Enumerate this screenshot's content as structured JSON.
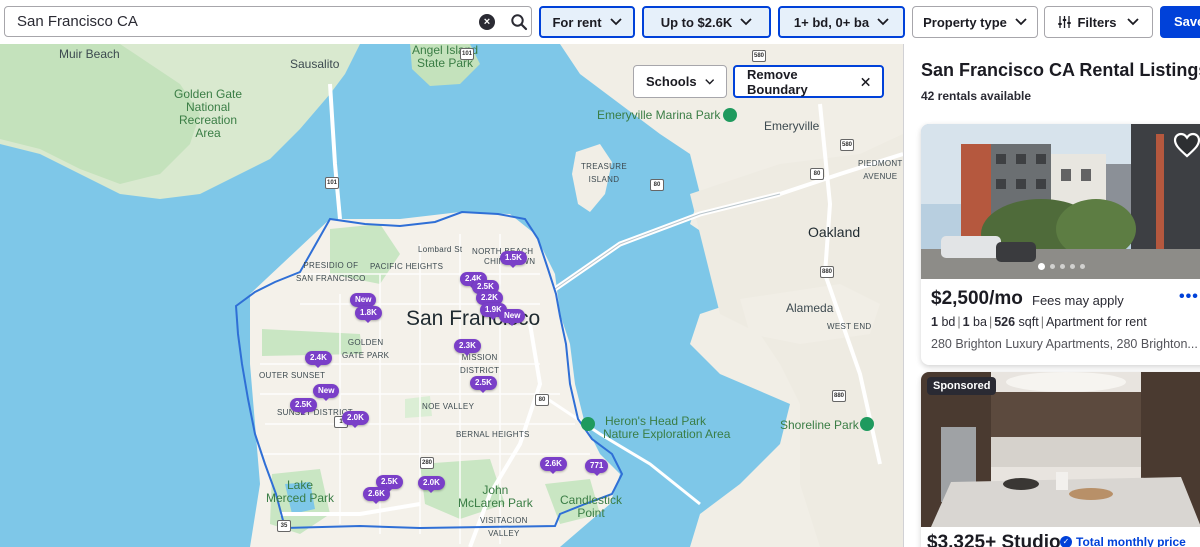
{
  "search": {
    "value": "San Francisco CA"
  },
  "filters": {
    "listing_type": "For rent",
    "price": "Up to $2.6K",
    "beds_baths": "1+ bd, 0+ ba",
    "property_type": "Property type",
    "more_filters": "Filters",
    "save": "Save"
  },
  "map": {
    "schools_button": "Schools",
    "remove_boundary_button": "Remove Boundary",
    "labels": {
      "muir_beach": "Muir Beach",
      "sausalito": "Sausalito",
      "angel_island": "Angel Island\nState Park",
      "golden_gate": "Golden Gate\nNational\nRecreation\nArea",
      "emeryville_marina": "Emeryville Marina Park",
      "emeryville": "Emeryville",
      "treasure_island": "TREASURE\nISLAND",
      "piedmont": "PIEDMONT\nAVENUE",
      "oakland": "Oakland",
      "north_beach": "NORTH BEACH",
      "chinatown": "CHINATOWN",
      "lombard": "Lombard St",
      "presidio": "PRESIDIO OF\nSAN FRANCISCO",
      "pacific_heights": "PACIFIC HEIGHTS",
      "san_francisco": "San Francisco",
      "golden_gate_park": "GOLDEN\nGATE PARK",
      "outer_sunset": "OUTER SUNSET",
      "mission_district": "MISSION\nDISTRICT",
      "sunset_district": "SUNSET DISTRICT",
      "noe_valley": "NOE VALLEY",
      "bernal_heights": "BERNAL HEIGHTS",
      "alameda": "Alameda",
      "west_end": "WEST END",
      "herons_head": "Heron's Head Park",
      "nature_area": "Nature Exploration Area",
      "shoreline_park": "Shoreline Park",
      "lake_merced": "Lake\nMerced Park",
      "john_mclaren": "John\nMcLaren Park",
      "visitacion": "VISITACION\nVALLEY",
      "candlestick": "Candlestick\nPoint"
    },
    "markers": [
      {
        "label": "1.5K"
      },
      {
        "label": "2.4K"
      },
      {
        "label": "2.5K"
      },
      {
        "label": "2.2K"
      },
      {
        "label": "1.9K"
      },
      {
        "label": "New"
      },
      {
        "label": "New"
      },
      {
        "label": "1.8K"
      },
      {
        "label": "2.3K"
      },
      {
        "label": "2.4K"
      },
      {
        "label": "New"
      },
      {
        "label": "2.5K"
      },
      {
        "label": "2.5K"
      },
      {
        "label": "2.0K"
      },
      {
        "label": "2.5K"
      },
      {
        "label": "2.0K"
      },
      {
        "label": "2.6K"
      },
      {
        "label": "2.6K"
      },
      {
        "label": "771"
      }
    ],
    "highway_shields": [
      "101",
      "101",
      "580",
      "80",
      "80",
      "880",
      "880",
      "280",
      "80",
      "580",
      "35",
      "1"
    ]
  },
  "panel": {
    "title": "San Francisco CA Rental Listings",
    "count": "42 rentals available",
    "listings": [
      {
        "price": "$2,500/mo",
        "fees": "Fees may apply",
        "beds": "1",
        "beds_unit": "bd",
        "baths": "1",
        "baths_unit": "ba",
        "sqft": "526",
        "sqft_unit": "sqft",
        "type": "Apartment for rent",
        "address": "280 Brighton Luxury Apartments, 280 Brighton..."
      },
      {
        "badge": "Sponsored",
        "price": "$3,325+ Studio",
        "total_monthly": "Total monthly price"
      }
    ]
  },
  "colors": {
    "accent": "#0041d9",
    "marker": "#7a3fc8",
    "water": "#7ec7e8",
    "land": "#f4f1ea",
    "park": "#c9e6c3"
  }
}
